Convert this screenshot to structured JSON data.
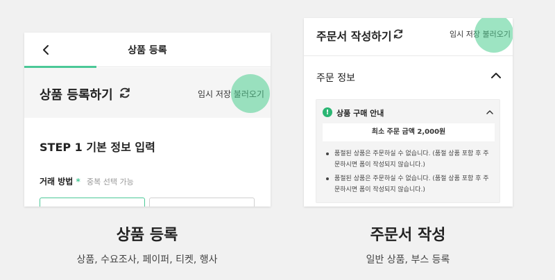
{
  "left_panel": {
    "nav_title": "상품 등록",
    "title": "상품 등록하기",
    "temp_load": "임시 저장 불러오기",
    "step_title": "STEP 1 기본 정보 입력",
    "trade_label": "거래 방법",
    "required_mark": "*",
    "trade_sub": "중복 선택 가능",
    "caption_title": "상품 등록",
    "caption_sub": "상품, 수요조사, 페이퍼, 티켓, 행사"
  },
  "right_panel": {
    "title": "주문서 작성하기",
    "temp_load": "임시 저장 불러오기",
    "section_title": "주문 정보",
    "notice": {
      "icon": "exclamation-icon",
      "title": "상품 구매 안내",
      "min_order": "최소 주문 금액 2,000원",
      "bullets": [
        "품절된 상품은 주문하실 수 없습니다. (품절 상품 포함 후 주문하시면 폼이 작성되지 않습니다.)",
        "품절된 상품은 주문하실 수 없습니다. (품절 상품 포함 후 주문하시면 폼이 작성되지 않습니다.)"
      ]
    },
    "caption_title": "주문서 작성",
    "caption_sub": "일반 상품, 부스 등록"
  },
  "colors": {
    "accent": "#4bc897",
    "highlight": "#7dd9ad",
    "notice_icon": "#2bb673",
    "background": "#f1f1f1"
  }
}
